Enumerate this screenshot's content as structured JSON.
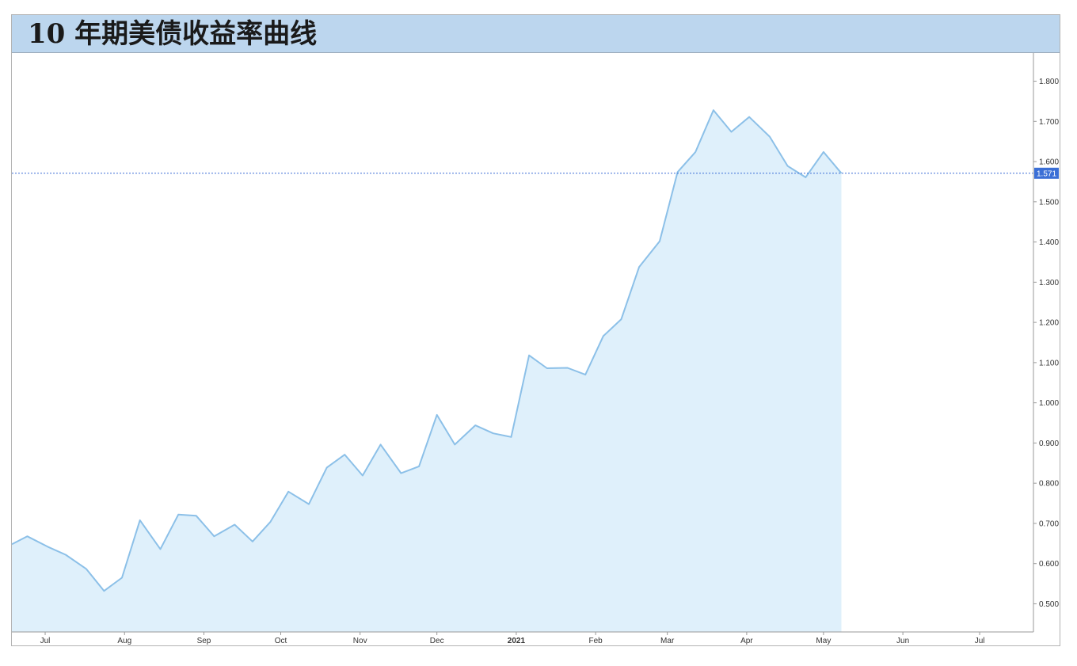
{
  "header": {
    "title": "10 年期美债收益率曲线"
  },
  "chart_data": {
    "type": "area",
    "title": "10 年期美债收益率曲线",
    "xlabel": "",
    "ylabel": "",
    "ylim": [
      0.43,
      1.87
    ],
    "xlim": [
      "2020-06-18",
      "2021-07-22"
    ],
    "grid": false,
    "legend": "none",
    "colors": {
      "line": "#8cc0e8",
      "fill": "#dff0fb",
      "current": "#3b6fd6",
      "badge": "#3b6fd6"
    },
    "y_ticks": [
      "0.500",
      "0.600",
      "0.700",
      "0.800",
      "0.900",
      "1.000",
      "1.100",
      "1.200",
      "1.300",
      "1.400",
      "1.500",
      "1.600",
      "1.700",
      "1.800"
    ],
    "x_ticks": [
      {
        "label": "Jul",
        "date": "2020-07-01"
      },
      {
        "label": "Aug",
        "date": "2020-08-01"
      },
      {
        "label": "Sep",
        "date": "2020-09-01"
      },
      {
        "label": "Oct",
        "date": "2020-10-01"
      },
      {
        "label": "Nov",
        "date": "2020-11-01"
      },
      {
        "label": "Dec",
        "date": "2020-12-01"
      },
      {
        "label": "2021",
        "date": "2021-01-01",
        "bold": true
      },
      {
        "label": "Feb",
        "date": "2021-02-01"
      },
      {
        "label": "Mar",
        "date": "2021-03-01"
      },
      {
        "label": "Apr",
        "date": "2021-04-01"
      },
      {
        "label": "May",
        "date": "2021-05-01"
      },
      {
        "label": "Jun",
        "date": "2021-06-01"
      },
      {
        "label": "Jul",
        "date": "2021-07-01"
      }
    ],
    "current_value": 1.571,
    "current_label": "1.571",
    "points": [
      [
        "2020-06-18",
        0.648
      ],
      [
        "2020-06-24",
        0.668
      ],
      [
        "2020-07-02",
        0.642
      ],
      [
        "2020-07-09",
        0.622
      ],
      [
        "2020-07-17",
        0.587
      ],
      [
        "2020-07-24",
        0.532
      ],
      [
        "2020-07-31",
        0.565
      ],
      [
        "2020-08-07",
        0.708
      ],
      [
        "2020-08-15",
        0.636
      ],
      [
        "2020-08-22",
        0.722
      ],
      [
        "2020-08-29",
        0.719
      ],
      [
        "2020-09-05",
        0.668
      ],
      [
        "2020-09-13",
        0.697
      ],
      [
        "2020-09-20",
        0.655
      ],
      [
        "2020-09-27",
        0.704
      ],
      [
        "2020-10-04",
        0.779
      ],
      [
        "2020-10-12",
        0.748
      ],
      [
        "2020-10-19",
        0.839
      ],
      [
        "2020-10-26",
        0.871
      ],
      [
        "2020-11-02",
        0.819
      ],
      [
        "2020-11-09",
        0.896
      ],
      [
        "2020-11-17",
        0.825
      ],
      [
        "2020-11-24",
        0.842
      ],
      [
        "2020-12-01",
        0.97
      ],
      [
        "2020-12-08",
        0.896
      ],
      [
        "2020-12-16",
        0.944
      ],
      [
        "2020-12-23",
        0.924
      ],
      [
        "2020-12-30",
        0.915
      ],
      [
        "2021-01-06",
        1.118
      ],
      [
        "2021-01-13",
        1.086
      ],
      [
        "2021-01-21",
        1.087
      ],
      [
        "2021-01-28",
        1.07
      ],
      [
        "2021-02-04",
        1.166
      ],
      [
        "2021-02-11",
        1.208
      ],
      [
        "2021-02-18",
        1.338
      ],
      [
        "2021-02-26",
        1.402
      ],
      [
        "2021-03-05",
        1.574
      ],
      [
        "2021-03-12",
        1.624
      ],
      [
        "2021-03-19",
        1.728
      ],
      [
        "2021-03-26",
        1.674
      ],
      [
        "2021-04-02",
        1.711
      ],
      [
        "2021-04-10",
        1.662
      ],
      [
        "2021-04-17",
        1.589
      ],
      [
        "2021-04-24",
        1.561
      ],
      [
        "2021-05-01",
        1.624
      ],
      [
        "2021-05-08",
        1.571
      ]
    ]
  }
}
